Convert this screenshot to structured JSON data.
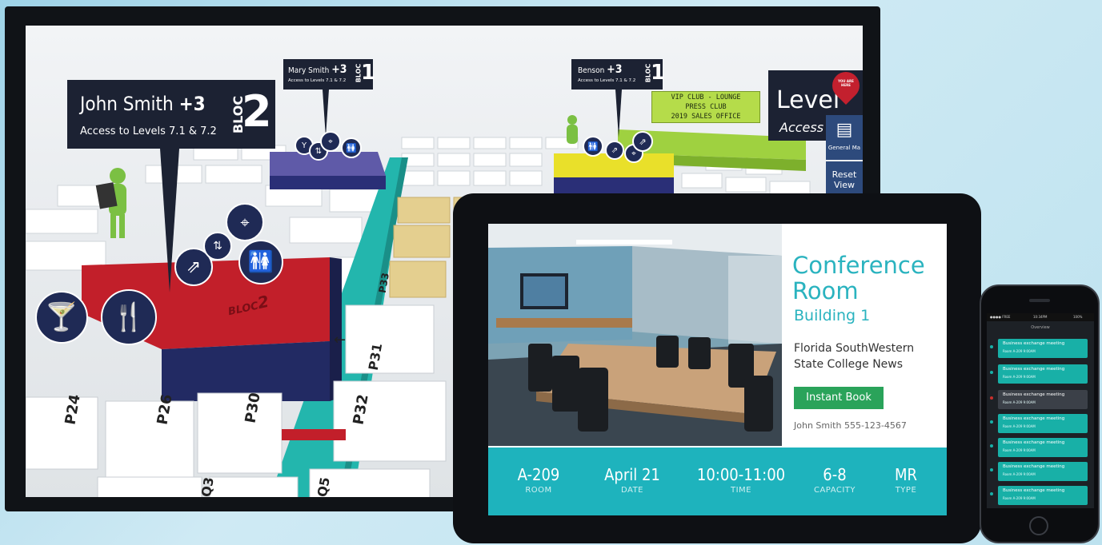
{
  "map": {
    "tag_john": {
      "name": "John Smith",
      "plus": "+3",
      "access": "Access to Levels 7.1 & 7.2",
      "bloc_word": "BLOC",
      "bloc_num": "2"
    },
    "tag_mary": {
      "name": "Mary Smith",
      "plus": "+3",
      "access": "Access to Levels 7.1 & 7.2",
      "bloc_word": "BLOC",
      "bloc_num": "1"
    },
    "tag_benson": {
      "name": "Benson",
      "plus": "+3",
      "access": "Access to Levels 7.1 & 7.2",
      "bloc_word": "BLOC",
      "bloc_num": "1"
    },
    "vip_sign": {
      "line1": "VIP CLUB - LOUNGE",
      "line2": "PRESS CLUB",
      "line3": "2019 SALES OFFICE"
    },
    "level_panel": {
      "title": "Level",
      "subtitle": "Access",
      "you_are_here": "YOU ARE HERE",
      "general_map": "General Ma",
      "reset_line1": "Reset",
      "reset_line2": "View"
    },
    "floor_bloc_label": "BLOC",
    "floor_bloc_num": "2",
    "booths": [
      "P24",
      "P26",
      "P30",
      "P31",
      "P32",
      "P33",
      "Q3",
      "Q5"
    ]
  },
  "tablet": {
    "title_line1": "Conference",
    "title_line2": "Room",
    "building": "Building 1",
    "org_line1": "Florida SouthWestern",
    "org_line2": "State College News",
    "book_button": "Instant Book",
    "contact": "John Smith 555-123-4567",
    "stats": [
      {
        "value": "A-209",
        "label": "ROOM"
      },
      {
        "value": "April 21",
        "label": "DATE"
      },
      {
        "value": "10:00-11:00",
        "label": "TIME"
      },
      {
        "value": "6-8",
        "label": "CAPACITY"
      },
      {
        "value": "MR",
        "label": "TYPE"
      }
    ]
  },
  "phone": {
    "status_left": "●●●● FREE",
    "status_time": "10:34PM",
    "status_right": "100%",
    "header": "Overview",
    "rows": [
      {
        "title": "Business exchange meeting",
        "sub": "Room A-209    9:00AM",
        "active": true
      },
      {
        "title": "Business exchange meeting",
        "sub": "Room A-209    9:00AM",
        "active": true
      },
      {
        "title": "Business exchange meeting",
        "sub": "Room A-209    9:00AM",
        "active": false
      },
      {
        "title": "Business exchange meeting",
        "sub": "Room A-209    9:00AM",
        "active": true
      },
      {
        "title": "Business exchange meeting",
        "sub": "Room A-209    9:00AM",
        "active": true
      },
      {
        "title": "Business exchange meeting",
        "sub": "Room A-209    9:00AM",
        "active": true
      },
      {
        "title": "Business exchange meeting",
        "sub": "Room A-209    9:00AM",
        "active": true
      }
    ]
  },
  "colors": {
    "teal": "#1eb3bd",
    "bloc_red": "#c21f2a",
    "bloc_navy": "#1f2a55",
    "bloc_purple": "#5f5aa8",
    "bloc_yellow": "#e9e02a",
    "lounge_green": "#9fd140",
    "book_green": "#2aa35a"
  }
}
